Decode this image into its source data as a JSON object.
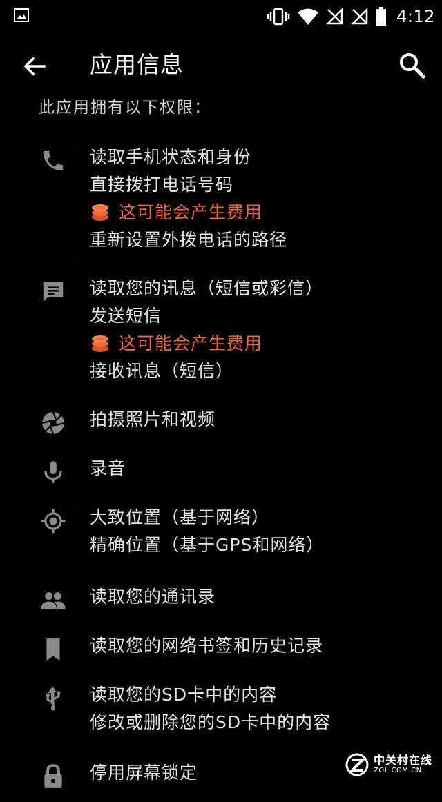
{
  "status_bar": {
    "time": "4:12",
    "icons": [
      "image-icon",
      "vibrate-icon",
      "wifi-icon",
      "no-signal-icon",
      "no-signal-icon",
      "battery-icon"
    ]
  },
  "app_bar": {
    "title": "应用信息",
    "back_icon": "arrow-back-icon",
    "search_icon": "search-icon"
  },
  "subheader": "此应用拥有以下权限：",
  "groups": [
    {
      "icon": "phone-icon",
      "lines": [
        {
          "text": "读取手机状态和身份"
        },
        {
          "text": "直接拨打电话号码"
        },
        {
          "text": "这可能会产生费用",
          "warning": true
        },
        {
          "text": "重新设置外拨电话的路径"
        }
      ]
    },
    {
      "icon": "message-icon",
      "lines": [
        {
          "text": "读取您的讯息（短信或彩信）"
        },
        {
          "text": "发送短信"
        },
        {
          "text": "这可能会产生费用",
          "warning": true
        },
        {
          "text": "接收讯息（短信）"
        }
      ]
    },
    {
      "icon": "camera-icon",
      "lines": [
        {
          "text": "拍摄照片和视频"
        }
      ]
    },
    {
      "icon": "microphone-icon",
      "lines": [
        {
          "text": "录音"
        }
      ]
    },
    {
      "icon": "location-icon",
      "lines": [
        {
          "text": "大致位置（基于网络）"
        },
        {
          "text": "精确位置（基于GPS和网络）"
        }
      ]
    },
    {
      "icon": "contacts-icon",
      "lines": [
        {
          "text": "读取您的通讯录"
        }
      ]
    },
    {
      "icon": "bookmark-icon",
      "lines": [
        {
          "text": "读取您的网络书签和历史记录"
        }
      ]
    },
    {
      "icon": "usb-icon",
      "lines": [
        {
          "text": "读取您的SD卡中的内容"
        },
        {
          "text": "修改或删除您的SD卡中的内容"
        }
      ]
    },
    {
      "icon": "lock-icon",
      "lines": [
        {
          "text": "停用屏幕锁定"
        }
      ]
    }
  ],
  "colors": {
    "background": "#000000",
    "text": "#e4e4e4",
    "warning": "#f0663e",
    "icon": "#8a8a8a"
  },
  "watermark": {
    "cn": "中关村在线",
    "en": "ZOL.COM.CN"
  }
}
